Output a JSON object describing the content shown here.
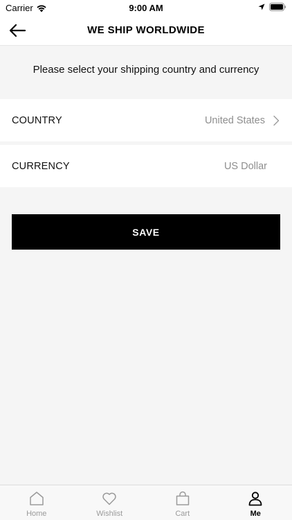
{
  "status_bar": {
    "carrier": "Carrier",
    "time": "9:00 AM"
  },
  "nav": {
    "title": "WE SHIP WORLDWIDE"
  },
  "prompt": "Please select your shipping country and currency",
  "country": {
    "label": "COUNTRY",
    "value": "United States"
  },
  "currency": {
    "label": "CURRENCY",
    "value": "US Dollar"
  },
  "save_label": "SAVE",
  "tabs": [
    {
      "label": "Home",
      "icon": "home-icon"
    },
    {
      "label": "Wishlist",
      "icon": "heart-icon"
    },
    {
      "label": "Cart",
      "icon": "bag-icon"
    },
    {
      "label": "Me",
      "icon": "person-icon",
      "active": true
    }
  ],
  "colors": {
    "background": "#f5f5f5",
    "primary": "#000000",
    "muted_text": "#8e8e8e",
    "inactive_tab": "#9a9a9a"
  }
}
